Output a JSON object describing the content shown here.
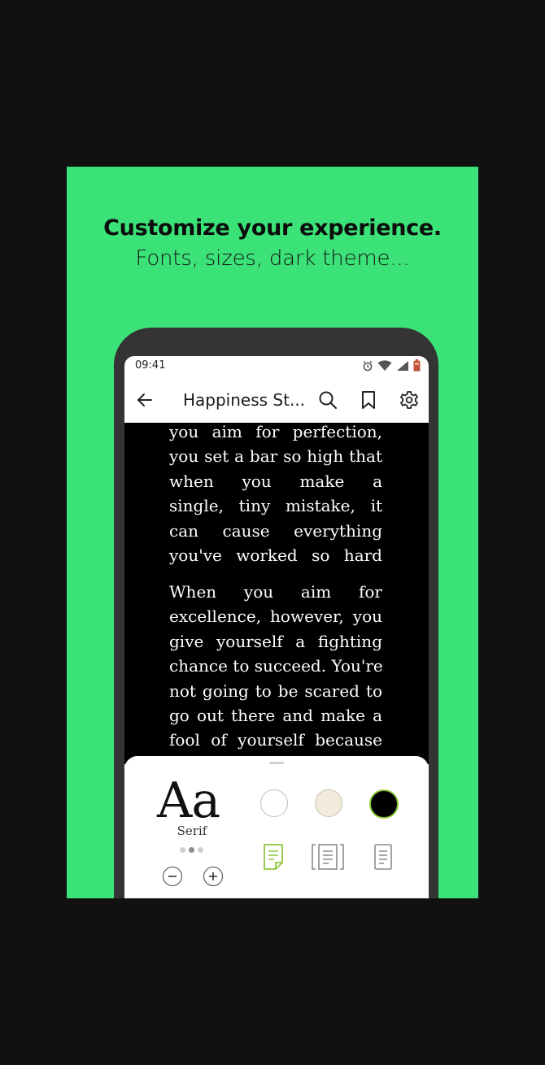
{
  "promo": {
    "headline": "Customize your experience.",
    "subline": "Fonts, sizes, dark theme..."
  },
  "status_bar": {
    "time": "09:41",
    "icons": [
      "alarm-icon",
      "wifi-icon",
      "signal-icon",
      "battery-icon"
    ]
  },
  "app_bar": {
    "back_icon": "arrow-left-icon",
    "title": "Happiness St...",
    "actions": [
      "search-icon",
      "bookmark-icon",
      "gear-icon"
    ]
  },
  "reader": {
    "paragraph1_lines": [
      "you aim for perfection,",
      "you set a bar so high that",
      "when you make a",
      "single, tiny mistake, it",
      "can cause everything",
      "you've worked so hard"
    ],
    "paragraph2_lines": [
      "When you aim for",
      "excellence, however, you",
      "give yourself a fighting",
      "chance to succeed. You're",
      "not going to be scared to",
      "go out there and make a",
      "fool of yourself because"
    ]
  },
  "settings_sheet": {
    "font_sample": "Aa",
    "font_name": "Serif",
    "font_page_indicator": {
      "count": 3,
      "active_index": 1
    },
    "size_controls": [
      "decrease-icon",
      "increase-icon"
    ],
    "themes": [
      {
        "name": "white",
        "color": "#ffffff"
      },
      {
        "name": "sepia",
        "color": "#f2ebdc"
      },
      {
        "name": "black",
        "color": "#000000",
        "selected": true
      }
    ],
    "layouts": [
      {
        "name": "page-curl-layout-icon",
        "selected": true
      },
      {
        "name": "two-page-layout-icon"
      },
      {
        "name": "single-page-layout-icon"
      }
    ],
    "accent_color": "#8dc63f"
  },
  "colors": {
    "background": "#111111",
    "card": "#3be277",
    "phone_frame": "#343434"
  }
}
